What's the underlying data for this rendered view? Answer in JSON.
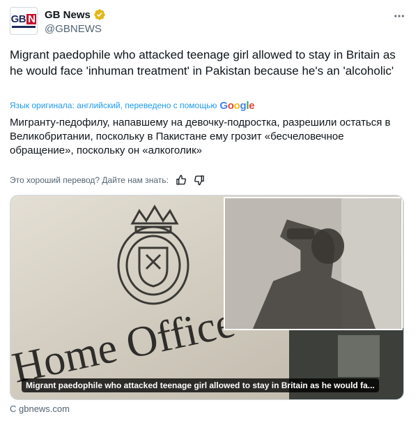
{
  "account": {
    "display_name": "GB News",
    "handle": "@GBNEWS",
    "logo_text_left": "GB",
    "logo_text_right": "N"
  },
  "tweet": {
    "original_text": "Migrant paedophile who attacked teenage girl allowed to stay in Britain as he would face 'inhuman treatment' in Pakistan because he's an 'alcoholic'",
    "translation_note": "Язык оригинала: английский, переведено с помощью",
    "google_letters": [
      "G",
      "o",
      "o",
      "g",
      "l",
      "e"
    ],
    "translated_text": "Мигранту-педофилу, напавшему на девочку-подростка, разрешили остаться в Великобритании, поскольку в Пакистане ему грозит «бесчеловечное обращение», поскольку он «алкоголик»",
    "feedback_prompt": "Это хороший перевод? Дайте нам знать:"
  },
  "media": {
    "sign_text": "Home Office",
    "caption": "Migrant paedophile who attacked teenage girl allowed to stay in Britain as he would fa..."
  },
  "source": "С gbnews.com",
  "colors": {
    "verified_gold": "#e2b719",
    "link_blue": "#1d9bf0",
    "secondary_text": "#536471",
    "brand_red": "#c8102e",
    "brand_navy": "#1b2a5c"
  },
  "icons": {
    "verified": "verified-badge-icon",
    "more": "more-options-icon",
    "thumbs_up": "thumbs-up-icon",
    "thumbs_down": "thumbs-down-icon"
  }
}
